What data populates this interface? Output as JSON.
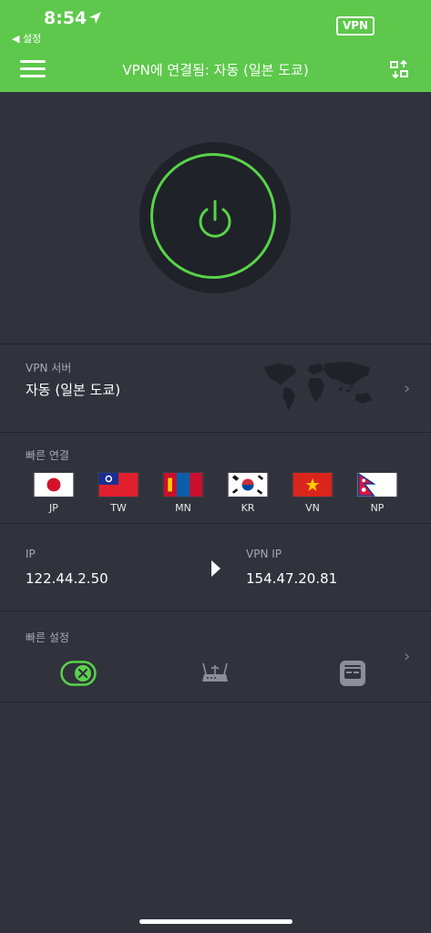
{
  "status_bar": {
    "time": "8:54",
    "back_label": "◀ 설정",
    "vpn_badge": "VPN"
  },
  "header": {
    "title": "VPN에 연결됨: 자동 (일본 도쿄)"
  },
  "server": {
    "label": "VPN 서버",
    "value": "자동 (일본 도쿄)"
  },
  "quick_connect": {
    "label": "빠른 연결",
    "countries": [
      {
        "code": "JP"
      },
      {
        "code": "TW"
      },
      {
        "code": "MN"
      },
      {
        "code": "KR"
      },
      {
        "code": "VN"
      },
      {
        "code": "NP"
      }
    ]
  },
  "ip_info": {
    "ip_label": "IP",
    "ip_value": "122.44.2.50",
    "vpn_ip_label": "VPN IP",
    "vpn_ip_value": "154.47.20.81"
  },
  "quick_settings": {
    "label": "빠른 설정"
  },
  "colors": {
    "accent": "#5dc84b",
    "background": "#30333c",
    "power_ring": "#58d34a"
  }
}
